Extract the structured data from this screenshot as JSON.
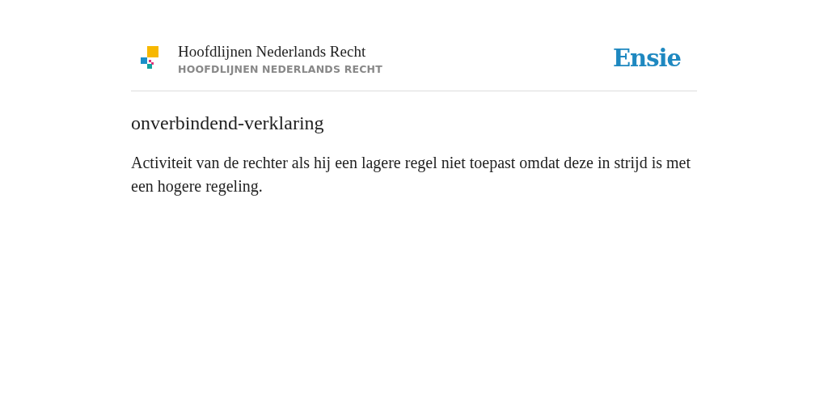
{
  "header": {
    "title": "Hoofdlijnen Nederlands Recht",
    "subtitle": "HOOFDLIJNEN NEDERLANDS RECHT",
    "brand": "Ensie"
  },
  "entry": {
    "term": "onverbindend-verklaring",
    "definition": "Activiteit van de rechter als hij een lagere regel niet toepast omdat deze in strijd is met een hogere regeling."
  }
}
